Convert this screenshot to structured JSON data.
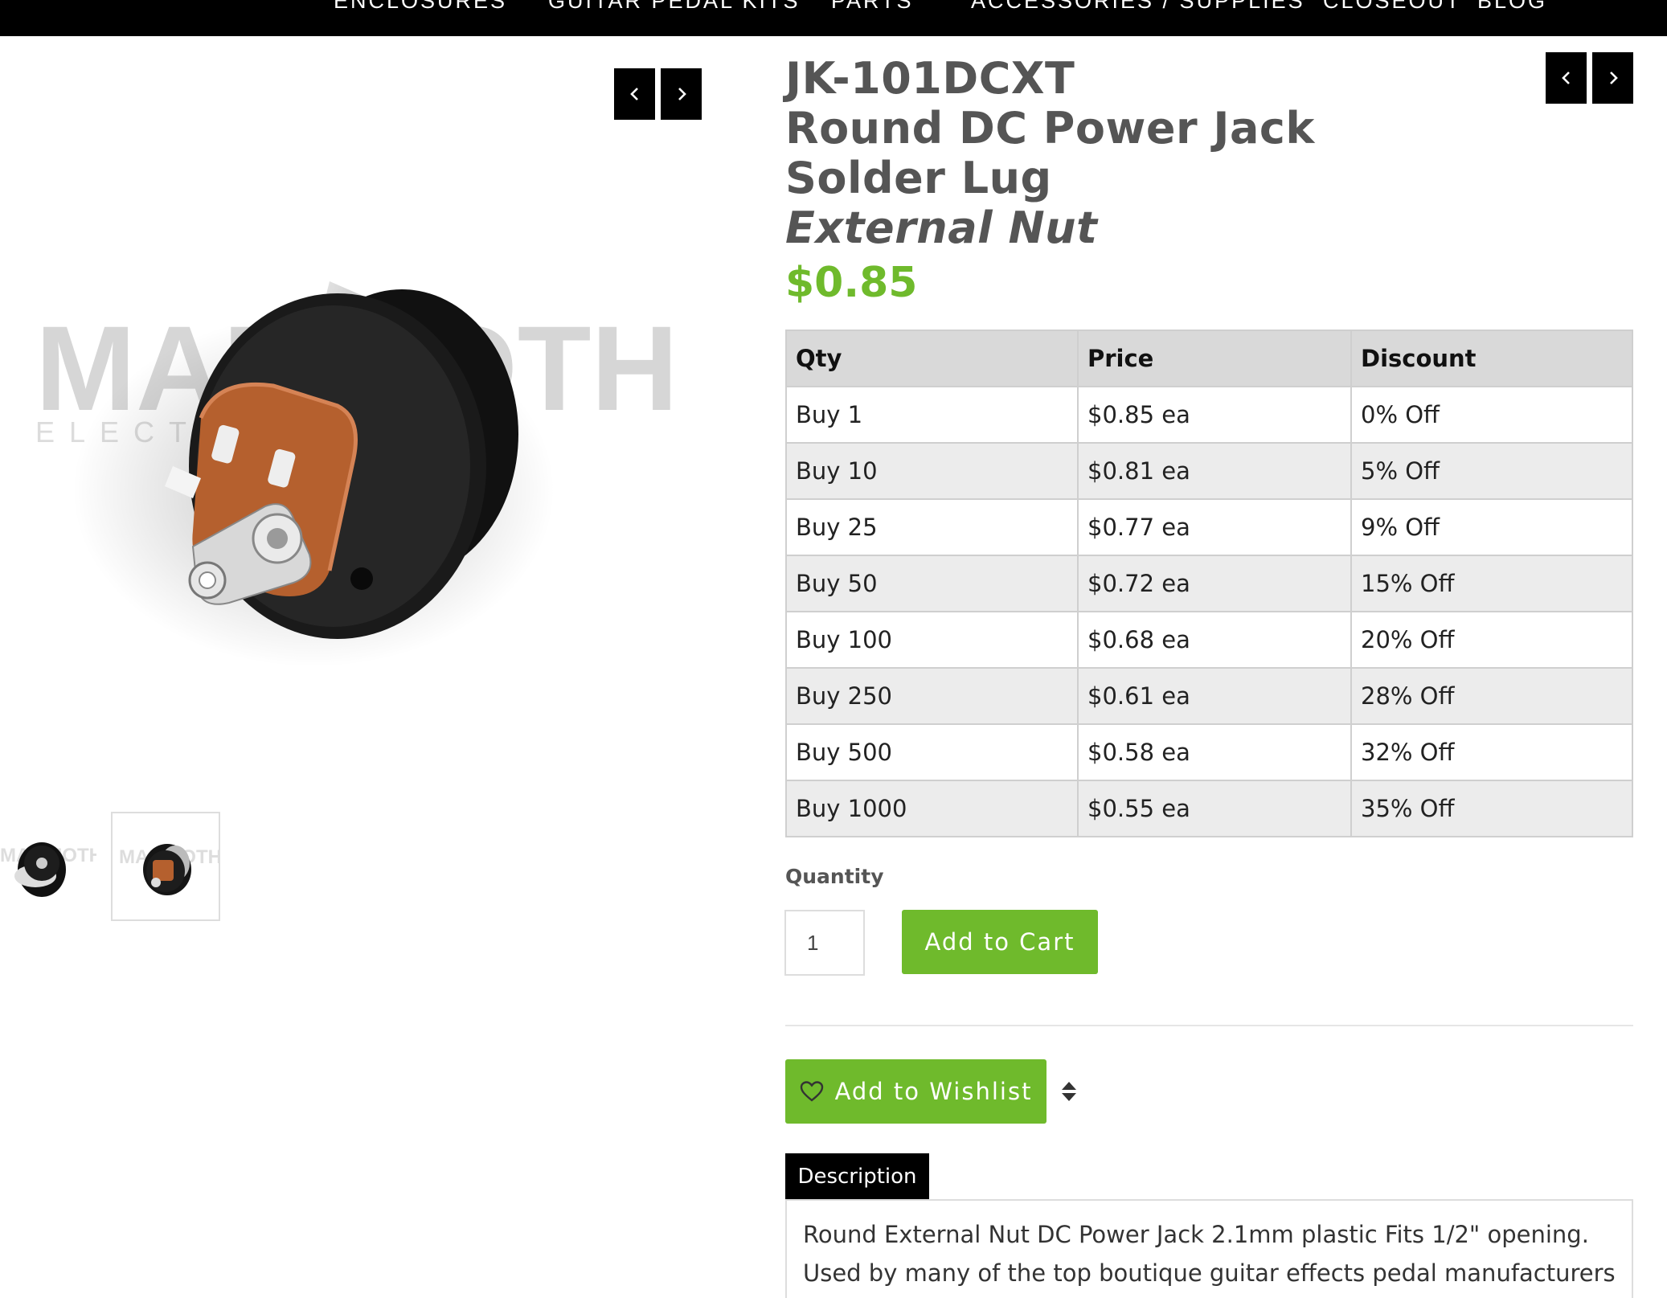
{
  "nav": {
    "items": [
      "ENCLOSURES",
      "GUITAR PEDAL KITS",
      "PARTS",
      "ACCESSORIES / SUPPLIES",
      "CLOSEOUT",
      "BLOG"
    ]
  },
  "product": {
    "sku": "JK-101DCXT",
    "name_line1": "Round DC Power Jack",
    "name_line2": "Solder Lug",
    "name_line3": "External Nut",
    "price": "$0.85",
    "image_watermark": "MAMMOTH",
    "image_watermark_sub": "ELECTRONICS"
  },
  "pricing_table": {
    "headers": [
      "Qty",
      "Price",
      "Discount"
    ],
    "rows": [
      [
        "Buy 1",
        "$0.85 ea",
        "0% Off"
      ],
      [
        "Buy 10",
        "$0.81 ea",
        "5% Off"
      ],
      [
        "Buy 25",
        "$0.77 ea",
        "9% Off"
      ],
      [
        "Buy 50",
        "$0.72 ea",
        "15% Off"
      ],
      [
        "Buy 100",
        "$0.68 ea",
        "20% Off"
      ],
      [
        "Buy 250",
        "$0.61 ea",
        "28% Off"
      ],
      [
        "Buy 500",
        "$0.58 ea",
        "32% Off"
      ],
      [
        "Buy 1000",
        "$0.55 ea",
        "35% Off"
      ]
    ]
  },
  "purchase": {
    "quantity_label": "Quantity",
    "quantity_value": "1",
    "add_to_cart_label": "Add to Cart",
    "add_to_wishlist_label": "Add to Wishlist"
  },
  "tabs": {
    "description_label": "Description",
    "description_text": "Round External Nut DC Power Jack 2.1mm plastic Fits 1/2\" opening. Used by many of the top boutique guitar effects pedal manufacturers in the world."
  },
  "icons": {
    "prev": "chevron-left-icon",
    "next": "chevron-right-icon",
    "wishlist": "heart-icon",
    "sort": "sort-icon"
  },
  "colors": {
    "accent_green": "#6fba2c",
    "nav_bg": "#000000",
    "title_gray": "#555555"
  }
}
